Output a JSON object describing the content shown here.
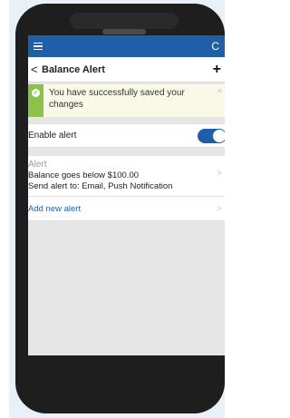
{
  "colors": {
    "accent": "#1f5fa8",
    "success": "#8cc24a"
  },
  "appbar": {
    "menu_icon": "hamburger-icon",
    "refresh_icon": "refresh-icon",
    "refresh_glyph": "C"
  },
  "header": {
    "back_glyph": "<",
    "title": "Balance Alert",
    "add_glyph": "+"
  },
  "banner": {
    "message": "You have successfully saved your changes",
    "close_glyph": "×"
  },
  "settings": {
    "enable_label": "Enable alert",
    "enabled": true
  },
  "alerts": [
    {
      "title": "Alert",
      "condition": "Balance goes below $100.00",
      "delivery": "Send alert to: Email, Push Notification"
    }
  ],
  "add_alert_label": "Add new alert",
  "chevron_glyph": ">"
}
